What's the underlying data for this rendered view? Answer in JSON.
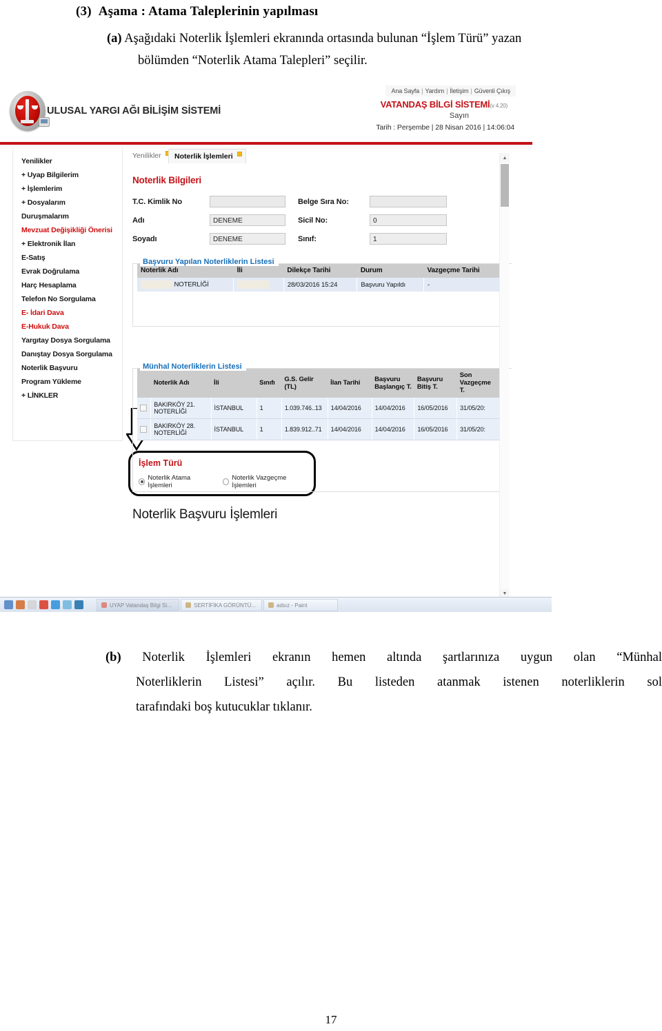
{
  "document": {
    "heading_number": "(3)",
    "heading_text": "Aşama : Atama Taleplerinin yapılması",
    "para_a_label": "(a)",
    "para_a_line1": "Aşağıdaki Noterlik İşlemleri ekranında ortasında bulunan “İşlem Türü” yazan",
    "para_a_line2": "bölümden “Noterlik Atama Talepleri” seçilir.",
    "para_b_label": "(b)",
    "para_b_line1": "Noterlik İşlemleri ekranın hemen altında şartlarınıza uygun olan “Münhal",
    "para_b_line2": "Noterliklerin Listesi” açılır.   Bu listeden atanmak istenen noterliklerin sol",
    "para_b_line3": "tarafındaki boş kutucuklar tıklanır.",
    "page_number": "17"
  },
  "screenshot": {
    "brand": {
      "logo_alt": "uyap-logo",
      "title": "ULUSAL YARGI AĞI BİLİŞİM SİSTEMİ"
    },
    "top_links": [
      "Ana Sayfa",
      "Yardım",
      "İletişim",
      "Güvenli Çıkış"
    ],
    "system": {
      "name": "VATANDAŞ BİLGİ SİSTEMİ",
      "version": "(v 4.20)",
      "greeting": "Sayın",
      "date_line": "Tarih : Perşembe | 28 Nisan 2016 | 14:06:04"
    },
    "sidebar": {
      "items": [
        {
          "label": "Yenilikler",
          "red": false
        },
        {
          "label": "+ Uyap Bilgilerim",
          "red": false
        },
        {
          "label": "+ İşlemlerim",
          "red": false
        },
        {
          "label": "+ Dosyalarım",
          "red": false
        },
        {
          "label": "Duruşmalarım",
          "red": false
        },
        {
          "label": "Mevzuat Değişikliği Önerisi",
          "red": true
        },
        {
          "label": "+ Elektronik İlan",
          "red": false
        },
        {
          "label": "E-Satış",
          "red": false
        },
        {
          "label": "Evrak Doğrulama",
          "red": false
        },
        {
          "label": "Harç Hesaplama",
          "red": false
        },
        {
          "label": "Telefon No Sorgulama",
          "red": false
        },
        {
          "label": "E- İdari Dava",
          "red": true
        },
        {
          "label": "E-Hukuk Dava",
          "red": true
        },
        {
          "label": "Yargıtay Dosya Sorgulama",
          "red": false
        },
        {
          "label": "Danıştay Dosya Sorgulama",
          "red": false
        },
        {
          "label": "Noterlik Başvuru",
          "red": false
        },
        {
          "label": "Program Yükleme",
          "red": false
        },
        {
          "label": "+ LİNKLER",
          "red": false
        }
      ]
    },
    "tabs": [
      {
        "label": "Yenilikler",
        "active": false
      },
      {
        "label": "Noterlik İşlemleri",
        "active": true
      }
    ],
    "noterlik_bilgileri": {
      "section_title": "Noterlik Bilgileri",
      "fields": [
        {
          "label": "T.C. Kimlik No",
          "value": ""
        },
        {
          "label": "Adı",
          "value": "DENEME"
        },
        {
          "label": "Soyadı",
          "value": "DENEME"
        }
      ],
      "fields_right": [
        {
          "label": "Belge Sıra No:",
          "value": ""
        },
        {
          "label": "Sicil No:",
          "value": "0"
        },
        {
          "label": "Sınıf:",
          "value": "1"
        }
      ]
    },
    "basvuru_listesi": {
      "legend": "Başvuru Yapılan Noterliklerin Listesi",
      "columns": [
        "Noterlik Adı",
        "İli",
        "Dilekçe Tarihi",
        "Durum",
        "Vazgeçme Tarihi"
      ],
      "rows": [
        {
          "noterlik_adi": "NOTERLİĞİ",
          "ili": "",
          "dilekce_tarihi": "28/03/2016 15:24",
          "durum": "Başvuru Yapıldı",
          "vazgecme_tarihi": "-"
        }
      ]
    },
    "islem_turu": {
      "title": "İşlem Türü",
      "options": [
        {
          "label": "Noterlik Atama İşlemleri",
          "selected": true
        },
        {
          "label": "Noterlik Vazgeçme İşlemleri",
          "selected": false
        }
      ]
    },
    "app_heading": "Noterlik Başvuru İşlemleri",
    "munhal_listesi": {
      "legend": "Münhal Noterliklerin Listesi",
      "columns": [
        "",
        "Noterlik Adı",
        "İli",
        "Sınıfı",
        "G.S. Gelir (TL)",
        "İlan Tarihi",
        "Başvuru Başlangıç T.",
        "Başvuru Bitiş T.",
        "Son Vazgeçme T."
      ],
      "rows": [
        {
          "checked": false,
          "noterlik_adi": "BAKIRKÖY 21. NOTERLİĞİ",
          "ili": "İSTANBUL",
          "sinifi": "1",
          "gelir": "1.039.746..13",
          "ilan_tarihi": "14/04/2016",
          "basvuru_baslangic": "14/04/2016",
          "basvuru_bitis": "16/05/2016",
          "son_vazgecme": "31/05/20:"
        },
        {
          "checked": false,
          "noterlik_adi": "BAKIRKÖY 28. NOTERLİĞİ",
          "ili": "İSTANBUL",
          "sinifi": "1",
          "gelir": "1.839.912..71",
          "ilan_tarihi": "14/04/2016",
          "basvuru_baslangic": "14/04/2016",
          "basvuru_bitis": "16/05/2016",
          "son_vazgecme": "31/05/20:"
        }
      ]
    },
    "scrollbar": {
      "up_arrow": "▲",
      "down_arrow": "▼"
    },
    "taskbar": {
      "buttons": [
        "UYAP Vatandaş Bilgi Si...",
        "SERTİFİKA GÖRÜNTÜ...",
        "adsız - Paint"
      ]
    },
    "colors": {
      "brand_red": "#c0161c",
      "legend_blue": "#1b6fb5",
      "table_header": "#c9c9c9",
      "table_row": "#dfe6f0"
    }
  }
}
